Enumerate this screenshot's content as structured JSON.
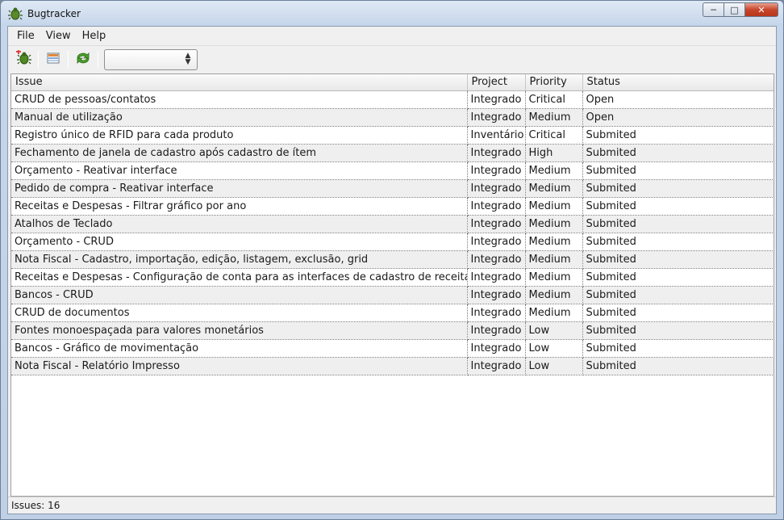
{
  "window": {
    "title": "Bugtracker",
    "accent": "#c7452a"
  },
  "icons": {
    "app": "bug-icon",
    "new_issue": "bug-add-icon",
    "view": "table-view-icon",
    "refresh": "refresh-icon"
  },
  "menu": {
    "file": "File",
    "view": "View",
    "help": "Help"
  },
  "toolbar": {
    "filter_value": ""
  },
  "table": {
    "headers": {
      "issue": "Issue",
      "project": "Project",
      "priority": "Priority",
      "status": "Status"
    },
    "rows": [
      {
        "issue": "CRUD de pessoas/contatos",
        "project": "Integrado",
        "priority": "Critical",
        "status": "Open"
      },
      {
        "issue": "Manual de utilização",
        "project": "Integrado",
        "priority": "Medium",
        "status": "Open"
      },
      {
        "issue": "Registro único de RFID para cada produto",
        "project": "Inventário",
        "priority": "Critical",
        "status": "Submited"
      },
      {
        "issue": "Fechamento de janela de cadastro após cadastro de ítem",
        "project": "Integrado",
        "priority": "High",
        "status": "Submited"
      },
      {
        "issue": "Orçamento - Reativar interface",
        "project": "Integrado",
        "priority": "Medium",
        "status": "Submited"
      },
      {
        "issue": "Pedido de compra - Reativar interface",
        "project": "Integrado",
        "priority": "Medium",
        "status": "Submited"
      },
      {
        "issue": "Receitas e Despesas - Filtrar gráfico por ano",
        "project": "Integrado",
        "priority": "Medium",
        "status": "Submited"
      },
      {
        "issue": "Atalhos de Teclado",
        "project": "Integrado",
        "priority": "Medium",
        "status": "Submited"
      },
      {
        "issue": "Orçamento - CRUD",
        "project": "Integrado",
        "priority": "Medium",
        "status": "Submited"
      },
      {
        "issue": "Nota Fiscal - Cadastro, importação, edição, listagem, exclusão, grid",
        "project": "Integrado",
        "priority": "Medium",
        "status": "Submited"
      },
      {
        "issue": "Receitas e Despesas - Configuração de conta para as interfaces de cadastro de receita",
        "project": "Integrado",
        "priority": "Medium",
        "status": "Submited"
      },
      {
        "issue": "Bancos - CRUD",
        "project": "Integrado",
        "priority": "Medium",
        "status": "Submited"
      },
      {
        "issue": "CRUD de documentos",
        "project": "Integrado",
        "priority": "Medium",
        "status": "Submited"
      },
      {
        "issue": "Fontes monoespaçada para valores monetários",
        "project": "Integrado",
        "priority": "Low",
        "status": "Submited"
      },
      {
        "issue": "Bancos - Gráfico de movimentação",
        "project": "Integrado",
        "priority": "Low",
        "status": "Submited"
      },
      {
        "issue": "Nota Fiscal - Relatório Impresso",
        "project": "Integrado",
        "priority": "Low",
        "status": "Submited"
      }
    ]
  },
  "statusbar": {
    "text": "Issues: 16"
  }
}
